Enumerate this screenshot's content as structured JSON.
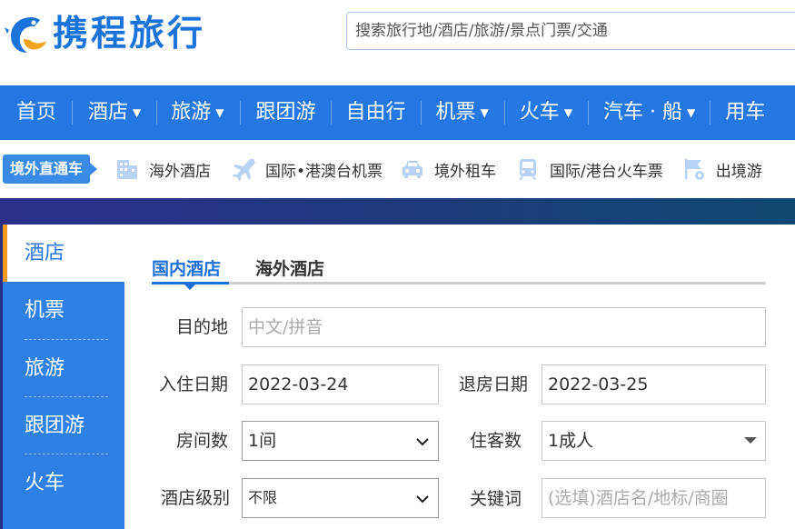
{
  "brand": {
    "name": "携程旅行"
  },
  "search": {
    "placeholder": "搜索旅行地/酒店/旅游/景点门票/交通"
  },
  "nav": [
    {
      "label": "首页"
    },
    {
      "label": "酒店"
    },
    {
      "label": "旅游"
    },
    {
      "label": "跟团游"
    },
    {
      "label": "自由行"
    },
    {
      "label": "机票"
    },
    {
      "label": "火车"
    },
    {
      "label": "汽车 · 船"
    },
    {
      "label": "用车"
    }
  ],
  "subnav": {
    "tag": "境外直通车",
    "items": [
      {
        "label": "海外酒店",
        "icon": "building-icon"
      },
      {
        "label": "国际•港澳台机票",
        "icon": "airplane-icon"
      },
      {
        "label": "境外租车",
        "icon": "car-icon"
      },
      {
        "label": "国际/港台火车票",
        "icon": "train-icon"
      },
      {
        "label": "出境游",
        "icon": "flag-icon"
      }
    ]
  },
  "side_menu": [
    {
      "label": "酒店"
    },
    {
      "label": "机票"
    },
    {
      "label": "旅游"
    },
    {
      "label": "跟团游"
    },
    {
      "label": "火车"
    }
  ],
  "tabs": [
    {
      "label": "国内酒店"
    },
    {
      "label": "海外酒店"
    }
  ],
  "form": {
    "destination": {
      "label": "目的地",
      "placeholder": "中文/拼音"
    },
    "checkin": {
      "label": "入住日期",
      "value": "2022-03-24"
    },
    "checkout": {
      "label": "退房日期",
      "value": "2022-03-25"
    },
    "rooms": {
      "label": "房间数",
      "value": "1间"
    },
    "guests": {
      "label": "住客数",
      "value": "1成人"
    },
    "hotel_level": {
      "label": "酒店级别",
      "value": "不限"
    },
    "keyword": {
      "label": "关键词",
      "placeholder": "(选填)酒店名/地标/商圈"
    }
  },
  "colors": {
    "brand_blue": "#2577e3",
    "tab_active": "#1a6fd8",
    "side_active_marker": "#f29b1d"
  }
}
